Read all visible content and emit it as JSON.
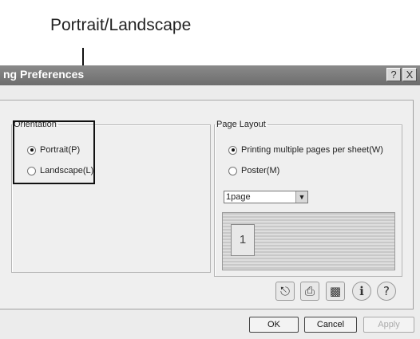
{
  "callout": {
    "label": "Portrait/Landscape"
  },
  "window": {
    "title": "ng Preferences",
    "help_button": "?",
    "close_button": "X"
  },
  "orientation": {
    "legend": "Orientation",
    "options": [
      {
        "label": "Portrait(P)",
        "selected": true
      },
      {
        "label": "Landscape(L)",
        "selected": false
      }
    ]
  },
  "page_layout": {
    "legend": "Page Layout",
    "options": [
      {
        "label": "Printing multiple pages per sheet(W)",
        "selected": true
      },
      {
        "label": "Poster(M)",
        "selected": false
      }
    ],
    "pages_select": {
      "value": "1page"
    },
    "preview_page_number": "1"
  },
  "toolbar_icons": [
    "print-preview-icon",
    "printer-icon",
    "toolbox-icon",
    "info-icon",
    "help-icon"
  ],
  "buttons": {
    "ok": "OK",
    "cancel": "Cancel",
    "apply": "Apply"
  }
}
